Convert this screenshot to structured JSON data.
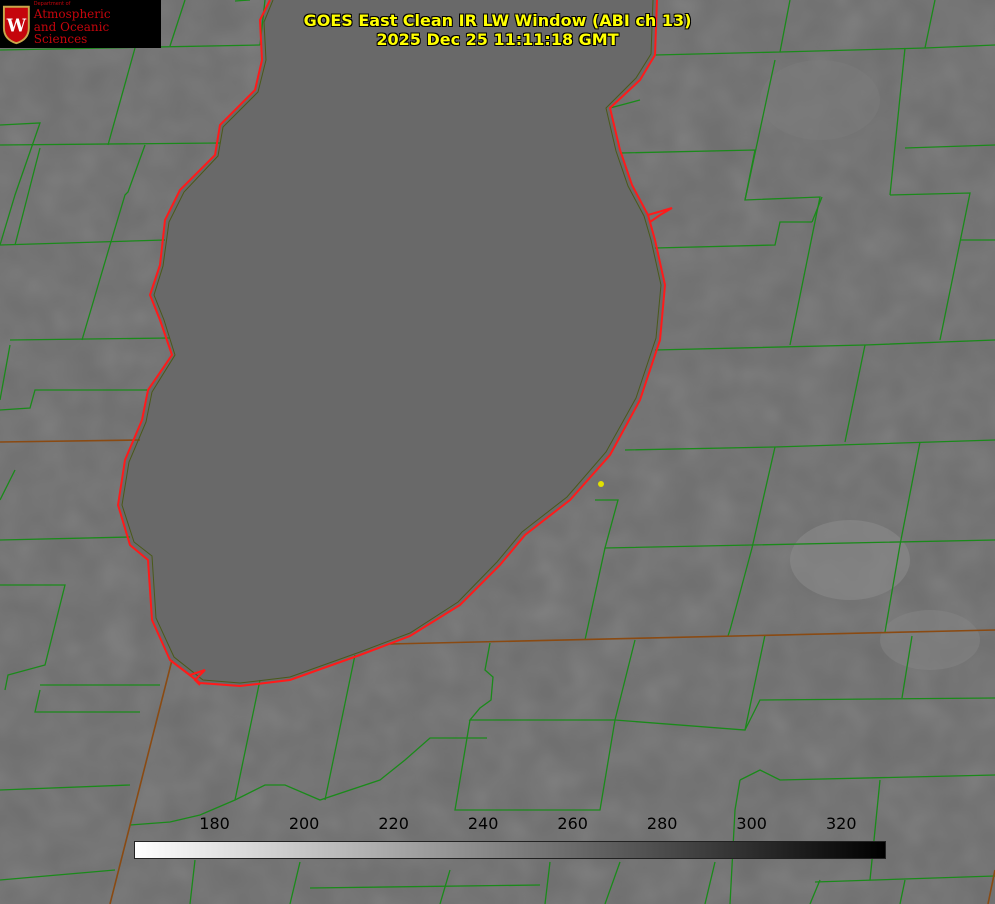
{
  "title": {
    "line1": "GOES East Clean IR LW Window (ABI ch 13)",
    "line2": "2025 Dec 25 11:11:18 GMT"
  },
  "logo": {
    "dept": "Department of",
    "line1": "Atmospheric",
    "line2": "and Oceanic Sciences",
    "crest_letter": "W"
  },
  "colorbar": {
    "ticks": [
      "180",
      "200",
      "220",
      "240",
      "260",
      "280",
      "300",
      "320"
    ],
    "range": [
      162,
      330
    ],
    "from_color": "#ffffff",
    "to_color": "#000000"
  },
  "colors": {
    "county_lines": "#1a8a1a",
    "state_lines": "#7a4a1a",
    "lake_outline": "#ff1a1a",
    "marker": "#e0e000",
    "background": "#6f6f6f"
  }
}
